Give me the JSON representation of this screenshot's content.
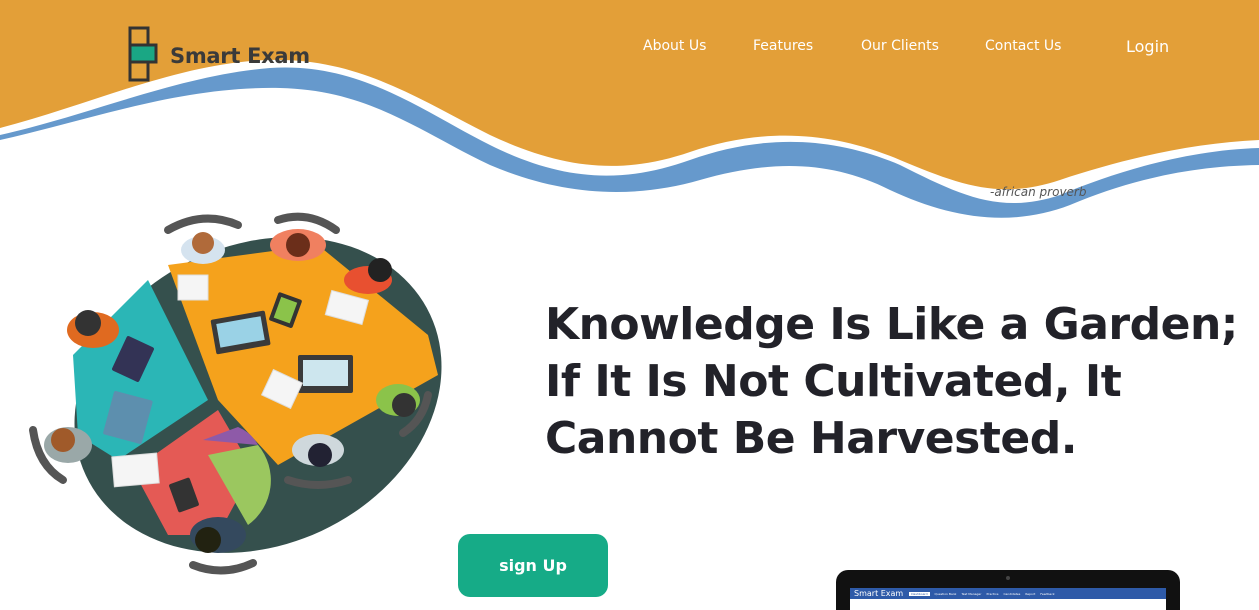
{
  "brand": {
    "name": "Smart Exam",
    "colors": {
      "orange": "#E39F38",
      "blue": "#6699CC",
      "dark": "#333333",
      "green": "#1AA784"
    }
  },
  "nav": {
    "items": [
      {
        "label": "About Us"
      },
      {
        "label": "Features"
      },
      {
        "label": "Our Clients"
      },
      {
        "label": "Contact Us"
      }
    ],
    "login": "Login"
  },
  "hero": {
    "proverb_attribution": "-african proverb",
    "headline_lines": [
      "Knowledge Is Like a Garden;",
      "If It Is Not Cultivated, It",
      "Cannot Be Harvested."
    ],
    "signup_label": "sign Up",
    "illustration_icon": "team-meeting-table-illustration"
  },
  "laptop_preview": {
    "brand": "Smart Exam",
    "tabs": [
      "Dashboard",
      "Question Bank",
      "Test Manager",
      "Practice",
      "Candidates",
      "Report",
      "Feedback"
    ]
  },
  "colors": {
    "header_bg": "#E39F38",
    "wave_accent": "#6699CC",
    "signup_bg": "#16AB87",
    "headline_text": "#222229"
  }
}
